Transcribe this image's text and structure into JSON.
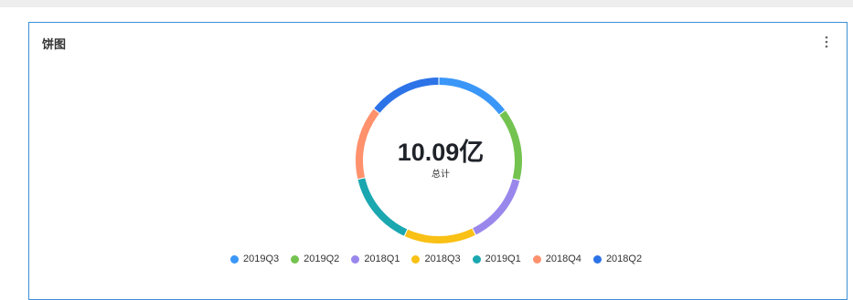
{
  "card": {
    "title": "饼图",
    "more_icon": "more-vertical-icon"
  },
  "center": {
    "value": "10.09亿",
    "label": "总计"
  },
  "chart_data": {
    "type": "pie",
    "donut": true,
    "categories": [
      "2019Q3",
      "2019Q2",
      "2018Q1",
      "2018Q3",
      "2019Q1",
      "2018Q4",
      "2018Q2"
    ],
    "values": [
      1.48,
      1.43,
      1.4,
      1.42,
      1.47,
      1.45,
      1.44
    ],
    "colors": [
      "#3a97f8",
      "#74c350",
      "#9a87ec",
      "#f9c015",
      "#1aa7b0",
      "#ff916c",
      "#2d73e8"
    ],
    "legend_position": "bottom"
  }
}
